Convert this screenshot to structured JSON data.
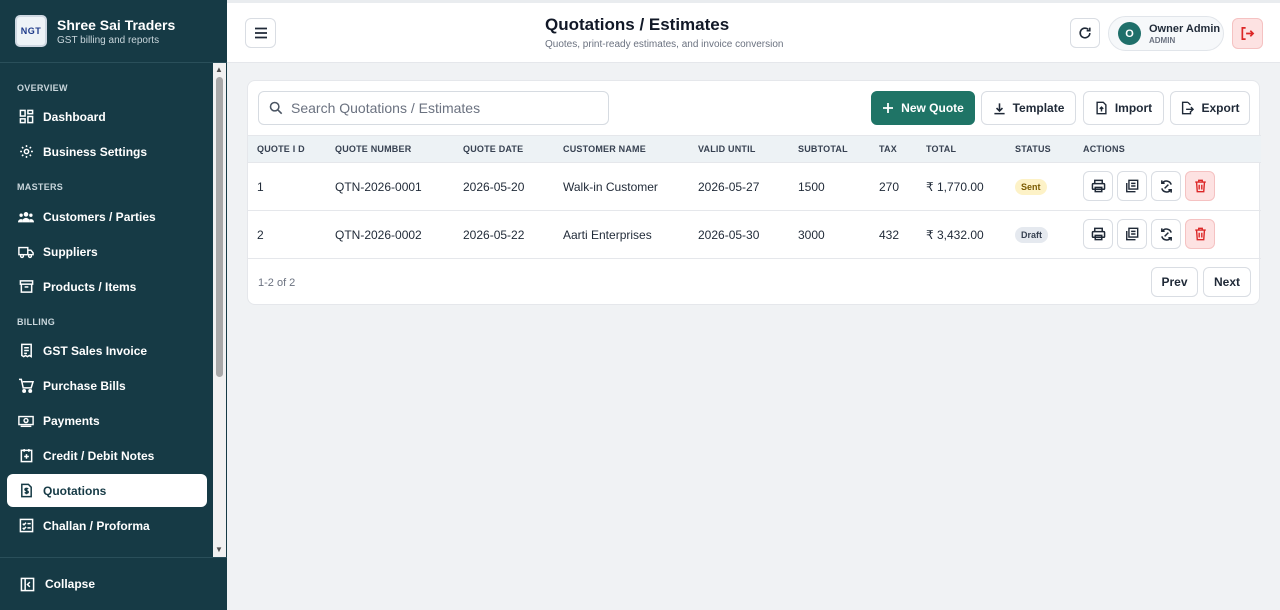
{
  "brand": {
    "logo_text": "NGT",
    "name": "Shree Sai Traders",
    "subtitle": "GST billing and reports"
  },
  "sidebar": {
    "sections": {
      "overview": "OVERVIEW",
      "masters": "MASTERS",
      "billing": "BILLING"
    },
    "items": [
      {
        "label": "Dashboard",
        "icon": "dashboard-icon"
      },
      {
        "label": "Business Settings",
        "icon": "gear-icon"
      },
      {
        "label": "Customers / Parties",
        "icon": "users-icon"
      },
      {
        "label": "Suppliers",
        "icon": "truck-icon"
      },
      {
        "label": "Products / Items",
        "icon": "archive-box-icon"
      },
      {
        "label": "GST Sales Invoice",
        "icon": "invoice-icon"
      },
      {
        "label": "Purchase Bills",
        "icon": "cart-icon"
      },
      {
        "label": "Payments",
        "icon": "money-icon"
      },
      {
        "label": "Credit / Debit Notes",
        "icon": "note-icon"
      },
      {
        "label": "Quotations",
        "icon": "quote-doc-icon",
        "active": true
      },
      {
        "label": "Challan / Proforma",
        "icon": "checklist-icon"
      }
    ],
    "collapse_label": "Collapse"
  },
  "header": {
    "title": "Quotations / Estimates",
    "subtitle": "Quotes, print-ready estimates, and invoice conversion",
    "user": {
      "initial": "O",
      "name": "Owner Admin",
      "role": "ADMIN"
    }
  },
  "toolbar": {
    "search_placeholder": "Search Quotations / Estimates",
    "new_quote": "New Quote",
    "template": "Template",
    "import": "Import",
    "export": "Export"
  },
  "table": {
    "columns": [
      "QUOTE I D",
      "QUOTE NUMBER",
      "QUOTE DATE",
      "CUSTOMER NAME",
      "VALID UNTIL",
      "SUBTOTAL",
      "TAX",
      "TOTAL",
      "STATUS",
      "ACTIONS"
    ],
    "rows": [
      {
        "id": "1",
        "number": "QTN-2026-0001",
        "date": "2026-05-20",
        "customer": "Walk-in Customer",
        "valid_until": "2026-05-27",
        "subtotal": "1500",
        "tax": "270",
        "total": "₹ 1,770.00",
        "status": "Sent"
      },
      {
        "id": "2",
        "number": "QTN-2026-0002",
        "date": "2026-05-22",
        "customer": "Aarti Enterprises",
        "valid_until": "2026-05-30",
        "subtotal": "3000",
        "tax": "432",
        "total": "₹ 3,432.00",
        "status": "Draft"
      }
    ]
  },
  "pagination": {
    "summary": "1-2 of 2",
    "prev": "Prev",
    "next": "Next"
  },
  "colors": {
    "sidebar_bg": "#163a45",
    "primary": "#1f7466",
    "danger": "#dc2626"
  }
}
